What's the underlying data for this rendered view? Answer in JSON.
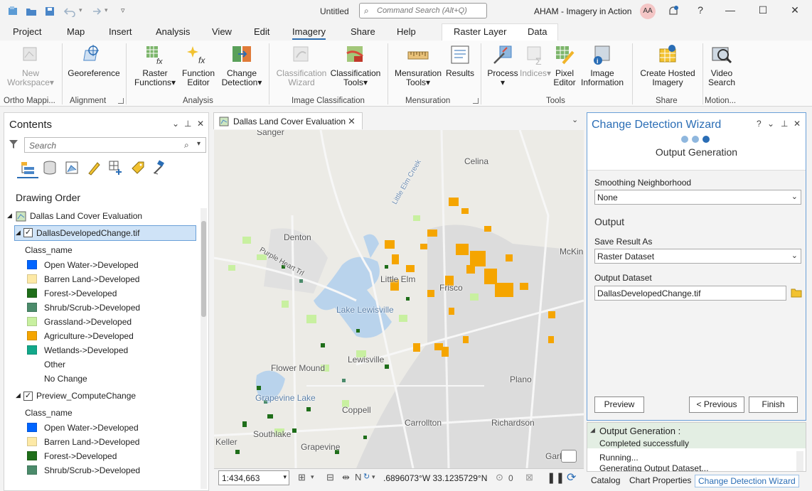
{
  "window": {
    "document_title": "Untitled",
    "command_search_placeholder": "Command Search (Alt+Q)",
    "project_title": "AHAM - Imagery in Action",
    "user_initials": "AA",
    "help": "?",
    "minimize": "—",
    "maximize": "☐",
    "close": "✕"
  },
  "ribbon_tabs": {
    "project": "Project",
    "map": "Map",
    "insert": "Insert",
    "analysis": "Analysis",
    "view": "View",
    "edit": "Edit",
    "imagery": "Imagery",
    "share": "Share",
    "help": "Help",
    "raster_layer": "Raster Layer",
    "data": "Data"
  },
  "ribbon": {
    "new_workspace": {
      "line1": "New",
      "line2": "Workspace"
    },
    "georeference": "Georeference",
    "raster_functions": {
      "line1": "Raster",
      "line2": "Functions"
    },
    "function_editor": {
      "line1": "Function",
      "line2": "Editor"
    },
    "change_detection": {
      "line1": "Change",
      "line2": "Detection"
    },
    "classification_wizard": {
      "line1": "Classification",
      "line2": "Wizard"
    },
    "classification_tools": {
      "line1": "Classification",
      "line2": "Tools"
    },
    "mensuration_tools": {
      "line1": "Mensuration",
      "line2": "Tools"
    },
    "results": "Results",
    "process": "Process",
    "indices": "Indices",
    "pixel_editor": {
      "line1": "Pixel",
      "line2": "Editor"
    },
    "image_information": {
      "line1": "Image",
      "line2": "Information"
    },
    "create_hosted_imagery": {
      "line1": "Create Hosted",
      "line2": "Imagery"
    },
    "video_search": {
      "line1": "Video",
      "line2": "Search"
    },
    "groups": {
      "ortho": "Ortho Mappi...",
      "alignment": "Alignment",
      "analysis": "Analysis",
      "image_classification": "Image Classification",
      "mensuration": "Mensuration",
      "tools": "Tools",
      "share": "Share",
      "motion": "Motion..."
    }
  },
  "contents": {
    "title": "Contents",
    "search_placeholder": "Search",
    "drawing_order": "Drawing Order",
    "map_name": "Dallas Land Cover Evaluation",
    "layer1": {
      "name": "DallasDevelopedChange.tif",
      "field": "Class_name",
      "classes": [
        {
          "label": "Open Water->Developed",
          "color": "#0064ff"
        },
        {
          "label": "Barren Land->Developed",
          "color": "#fde9a6"
        },
        {
          "label": "Forest->Developed",
          "color": "#1f6e1a"
        },
        {
          "label": "Shrub/Scrub->Developed",
          "color": "#4b8b6b"
        },
        {
          "label": "Grassland->Developed",
          "color": "#c8f0a0"
        },
        {
          "label": "Agriculture->Developed",
          "color": "#f5a500"
        },
        {
          "label": "Wetlands->Developed",
          "color": "#12a88a"
        },
        {
          "label": "Other",
          "color": ""
        },
        {
          "label": "No Change",
          "color": ""
        }
      ]
    },
    "layer2": {
      "name": "Preview_ComputeChange",
      "field": "Class_name",
      "classes": [
        {
          "label": "Open Water->Developed",
          "color": "#0064ff"
        },
        {
          "label": "Barren Land->Developed",
          "color": "#fde9a6"
        },
        {
          "label": "Forest->Developed",
          "color": "#1f6e1a"
        },
        {
          "label": "Shrub/Scrub->Developed",
          "color": "#4b8b6b"
        }
      ]
    }
  },
  "map": {
    "tab_title": "Dallas Land Cover Evaluation",
    "labels": {
      "sanger": "Sanger",
      "celina": "Celina",
      "denton": "Denton",
      "little_elm": "Little Elm",
      "frisco": "Frisco",
      "lake_lewisville": "Lake Lewisville",
      "lewisville": "Lewisville",
      "flower_mound": "Flower Mound",
      "grapevine_lake": "Grapevine Lake",
      "coppell": "Coppell",
      "plano": "Plano",
      "carrollton": "Carrollton",
      "richardson": "Richardson",
      "southlake": "Southlake",
      "grapevine": "Grapevine",
      "keller": "Keller",
      "garland": "Garl",
      "mckinney": "McKin",
      "little_elm_creek": "Little Elm Creek",
      "purple_heart": "Purple Heart Trl"
    },
    "scale": "1:434,663",
    "coordinates": ".6896073°W 33.1235729°N",
    "selected_count": "0"
  },
  "wizard": {
    "title": "Change Detection Wizard",
    "step_title": "Output Generation",
    "smoothing_label": "Smoothing Neighborhood",
    "smoothing_value": "None",
    "output_section": "Output",
    "save_as_label": "Save Result As",
    "save_as_value": "Raster Dataset",
    "output_dataset_label": "Output Dataset",
    "output_dataset_value": "DallasDevelopedChange.tif",
    "preview": "Preview",
    "previous": "< Previous",
    "finish": "Finish"
  },
  "messages": {
    "title": "Output Generation :",
    "status": "Completed successfully",
    "line1": "Running...",
    "line2": "Generating Output Dataset..."
  },
  "bottom_tabs": {
    "catalog": "Catalog",
    "chart_properties": "Chart Properties",
    "change_detection_wizard": "Change Detection Wizard"
  },
  "colors": {
    "accent": "#2a6db5",
    "agriculture": "#f5a500",
    "forest": "#1f6e1a",
    "grassland": "#c8f0a0"
  }
}
